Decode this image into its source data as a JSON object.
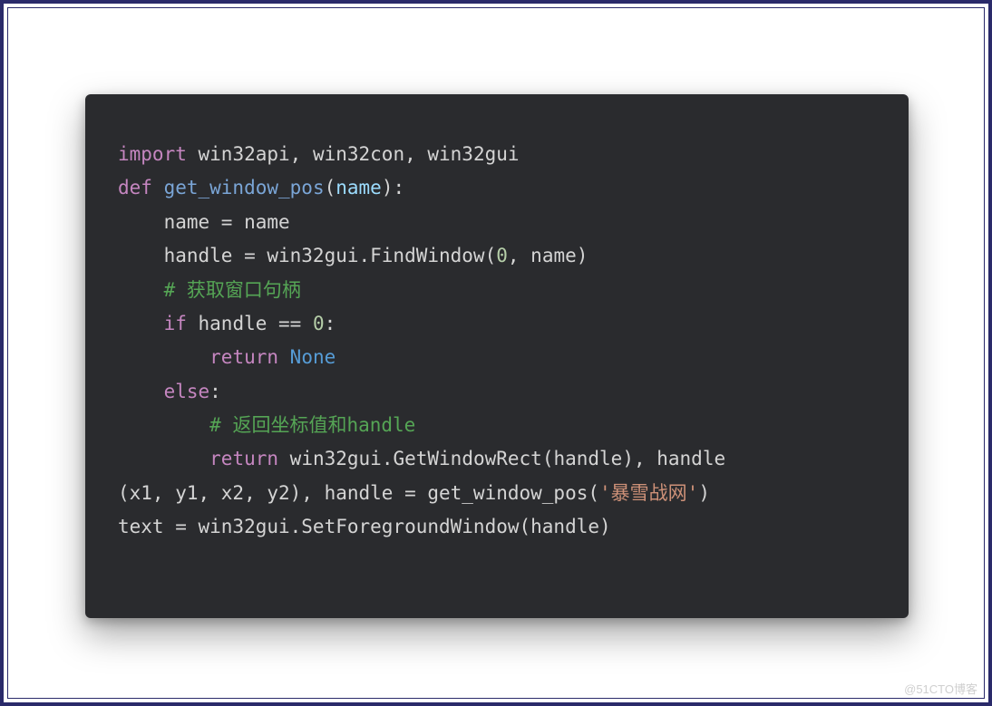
{
  "code": {
    "tokens": [
      [
        {
          "t": "import ",
          "c": "kw"
        },
        {
          "t": "win32api, win32con, win32gui",
          "c": "id"
        }
      ],
      [
        {
          "t": "def ",
          "c": "kw"
        },
        {
          "t": "get_window_pos",
          "c": "fn"
        },
        {
          "t": "(",
          "c": "id"
        },
        {
          "t": "name",
          "c": "param"
        },
        {
          "t": "):",
          "c": "id"
        }
      ],
      [
        {
          "t": "    name = name",
          "c": "id"
        }
      ],
      [
        {
          "t": "    handle = win32gui.FindWindow(",
          "c": "id"
        },
        {
          "t": "0",
          "c": "num"
        },
        {
          "t": ", name)",
          "c": "id"
        }
      ],
      [
        {
          "t": "    ",
          "c": "id"
        },
        {
          "t": "# 获取窗口句柄",
          "c": "cmt"
        }
      ],
      [
        {
          "t": "    ",
          "c": "id"
        },
        {
          "t": "if ",
          "c": "kw"
        },
        {
          "t": "handle == ",
          "c": "id"
        },
        {
          "t": "0",
          "c": "num"
        },
        {
          "t": ":",
          "c": "id"
        }
      ],
      [
        {
          "t": "        ",
          "c": "id"
        },
        {
          "t": "return ",
          "c": "kw"
        },
        {
          "t": "None",
          "c": "none"
        }
      ],
      [
        {
          "t": "    ",
          "c": "id"
        },
        {
          "t": "else",
          "c": "kw"
        },
        {
          "t": ":",
          "c": "id"
        }
      ],
      [
        {
          "t": "        ",
          "c": "id"
        },
        {
          "t": "# 返回坐标值和handle",
          "c": "cmt"
        }
      ],
      [
        {
          "t": "        ",
          "c": "id"
        },
        {
          "t": "return ",
          "c": "kw"
        },
        {
          "t": "win32gui.GetWindowRect(handle), handle",
          "c": "id"
        }
      ],
      [
        {
          "t": "(x1, y1, x2, y2), handle = get_window_pos(",
          "c": "id"
        },
        {
          "t": "'暴雪战网'",
          "c": "str"
        },
        {
          "t": ")",
          "c": "id"
        }
      ],
      [
        {
          "t": "text = win32gui.SetForegroundWindow(handle)",
          "c": "id"
        }
      ]
    ]
  },
  "watermark": "@51CTO博客"
}
